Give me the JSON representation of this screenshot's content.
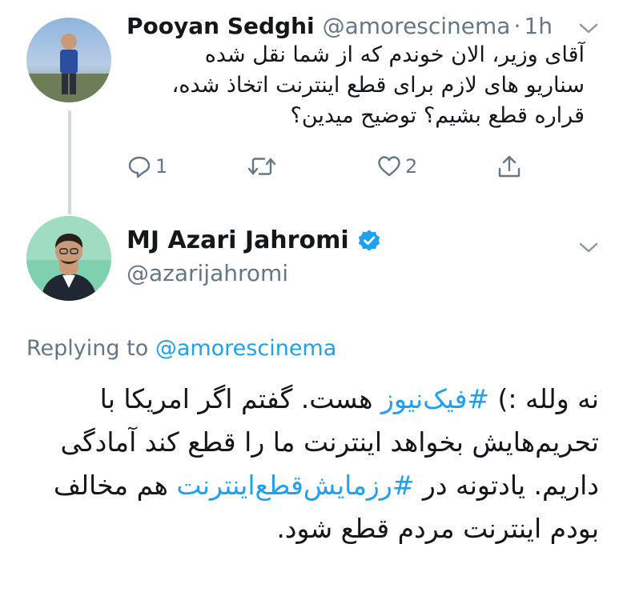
{
  "reply_tweet": {
    "author_name": "Pooyan Sedghi",
    "author_handle": "@amorescinema",
    "separator": "·",
    "time": "1h",
    "text": "آقای وزیر، الان خوندم که از شما نقل شده سناریو های لازم برای قطع اینترنت اتخاذ شده، قراره قطع بشیم؟ توضیح میدین؟",
    "reply_count": "1",
    "retweet_count": "",
    "like_count": "2"
  },
  "main_tweet": {
    "author_name": "MJ Azari Jahromi",
    "author_handle": "@azarijahromi",
    "replying_label": "Replying to",
    "replying_to": "@amorescinema",
    "text_part1": "نه ولله :) ",
    "hashtag1": "#فیک‌نیوز",
    "text_part2": " هست. گفتم اگر امریکا با تحریم‌هایش بخواهد اینترنت ما را قطع کند آمادگی داریم. یادتونه در ",
    "hashtag2": "#رزمایش‌قطع‌اینترنت",
    "text_part3": " هم مخالف بودم اینترنت مردم قطع شود."
  },
  "colors": {
    "link": "#1da1f2",
    "secondary": "#657786",
    "primary_text": "#14171a",
    "thread_line": "#cfd9de"
  },
  "icons": {
    "reply": "reply-icon",
    "retweet": "retweet-icon",
    "like": "heart-icon",
    "share": "share-icon",
    "verified": "verified-badge-icon",
    "caret": "chevron-down-icon"
  }
}
